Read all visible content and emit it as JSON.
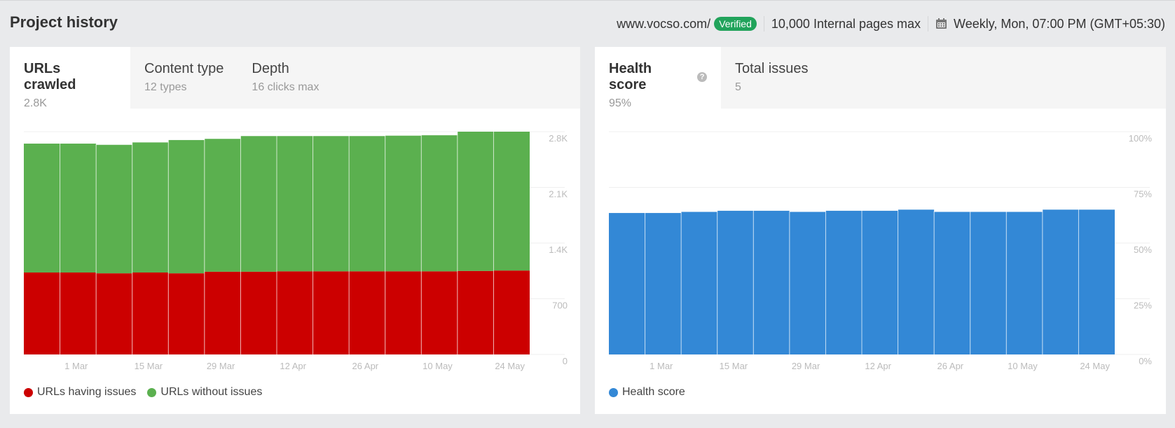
{
  "header": {
    "title": "Project history",
    "domain": "www.vocso.com/",
    "verified_label": "Verified",
    "pages_max": "10,000 Internal pages max",
    "calendar_icon": "calendar-icon",
    "schedule": "Weekly, Mon, 07:00 PM (GMT+05:30)"
  },
  "colors": {
    "verified": "#21a35b",
    "issues": "#cc0000",
    "no_issues": "#5bb04f",
    "health": "#3388d6"
  },
  "left_panel": {
    "tabs": [
      {
        "label": "URLs crawled",
        "sub": "2.8K",
        "active": true
      },
      {
        "label": "Content type",
        "sub": "12 types",
        "active": false
      },
      {
        "label": "Depth",
        "sub": "16 clicks max",
        "active": false
      }
    ],
    "legend": [
      {
        "label": "URLs having issues",
        "color": "#cc0000"
      },
      {
        "label": "URLs without issues",
        "color": "#5bb04f"
      }
    ]
  },
  "right_panel": {
    "tabs": [
      {
        "label": "Health score",
        "sub": "95%",
        "active": true,
        "help_icon": "question-icon"
      },
      {
        "label": "Total issues",
        "sub": "5",
        "active": false
      }
    ],
    "legend": [
      {
        "label": "Health score",
        "color": "#3388d6"
      }
    ]
  },
  "chart_data": [
    {
      "type": "bar",
      "stacked": true,
      "title": "URLs crawled",
      "x_tick_labels": [
        "1 Mar",
        "15 Mar",
        "29 Mar",
        "12 Apr",
        "26 Apr",
        "10 May",
        "24 May"
      ],
      "bar_count": 14,
      "y_ticks": [
        "0",
        "700",
        "1.4K",
        "2.1K",
        "2.8K"
      ],
      "y_tick_values": [
        0,
        700,
        1400,
        2100,
        2800
      ],
      "ylim": [
        0,
        2800
      ],
      "grid": true,
      "legend_position": "bottom-left",
      "series": [
        {
          "name": "URLs having issues",
          "color": "#cc0000",
          "values": [
            1030,
            1030,
            1020,
            1030,
            1020,
            1040,
            1040,
            1045,
            1045,
            1045,
            1045,
            1045,
            1050,
            1055
          ]
        },
        {
          "name": "URLs without issues",
          "color": "#5bb04f",
          "values": [
            1620,
            1620,
            1615,
            1635,
            1675,
            1670,
            1705,
            1700,
            1700,
            1700,
            1705,
            1710,
            1750,
            1745
          ]
        }
      ]
    },
    {
      "type": "bar",
      "title": "Health score",
      "x_tick_labels": [
        "1 Mar",
        "15 Mar",
        "29 Mar",
        "12 Apr",
        "26 Apr",
        "10 May",
        "24 May"
      ],
      "bar_count": 14,
      "y_ticks": [
        "0%",
        "25%",
        "50%",
        "75%",
        "100%"
      ],
      "y_tick_values": [
        0,
        25,
        50,
        75,
        100
      ],
      "ylim": [
        0,
        100
      ],
      "grid": true,
      "legend_position": "bottom-left",
      "series": [
        {
          "name": "Health score",
          "color": "#3388d6",
          "values": [
            63.5,
            63.5,
            64,
            64.5,
            64.5,
            64,
            64.5,
            64.5,
            65,
            64,
            64,
            64,
            65,
            65
          ]
        }
      ]
    }
  ]
}
